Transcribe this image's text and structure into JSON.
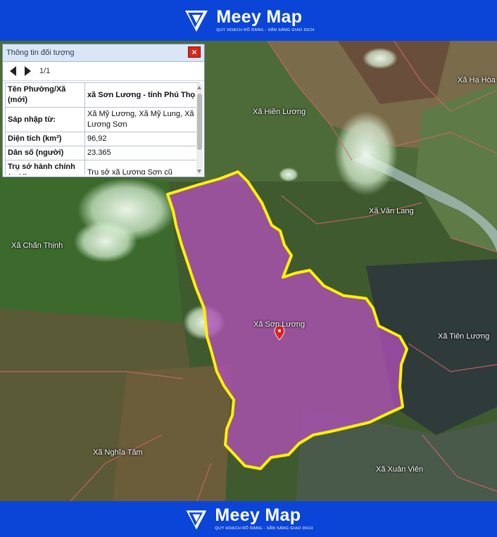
{
  "header": {
    "brand": "Meey Map",
    "tagline": "QUY HOẠCH RÕ RÀNG - SẴN SÀNG GIAO DỊCH"
  },
  "footer": {
    "brand": "Meey Map",
    "tagline": "QUY HOẠCH RÕ RÀNG - SẴN SÀNG GIAO DỊCH"
  },
  "panel": {
    "title": "Thông tin đối tượng",
    "close": "×",
    "page": "1/1",
    "rows": [
      {
        "key": "Tên Phường/Xã (mới)",
        "value": "xã Sơn Lương - tỉnh Phú Thọ",
        "value_bold": true
      },
      {
        "key": "Sáp nhập từ:",
        "value": "Xã Mỹ Lương, Xã Mỹ Lung, Xã Lương Sơn"
      },
      {
        "key": "Diện tích (km²)",
        "value": "96,92"
      },
      {
        "key": "Dân số (người)",
        "value": "23.365"
      },
      {
        "key": "Trụ sở hành chính (mới)",
        "value": "Trụ sở xã Lương Sơn cũ"
      }
    ]
  },
  "map": {
    "labels": {
      "ha_hoa": "Xã Hạ Hòa",
      "hien_luong": "Xã Hiền Lương",
      "van_lang": "Xã Văn Lang",
      "chan_thinh": "Xã Chấn Thịnh",
      "son_luong": "Xã Sơn Lương",
      "tien_luong": "Xã Tiên Lương",
      "nghia_tam": "Xã Nghĩa Tâm",
      "xuan_vien": "Xã Xuân Viên"
    },
    "highlight_fill": "#b04fb8",
    "highlight_border": "#fff200",
    "pin_color": "#e02020"
  }
}
